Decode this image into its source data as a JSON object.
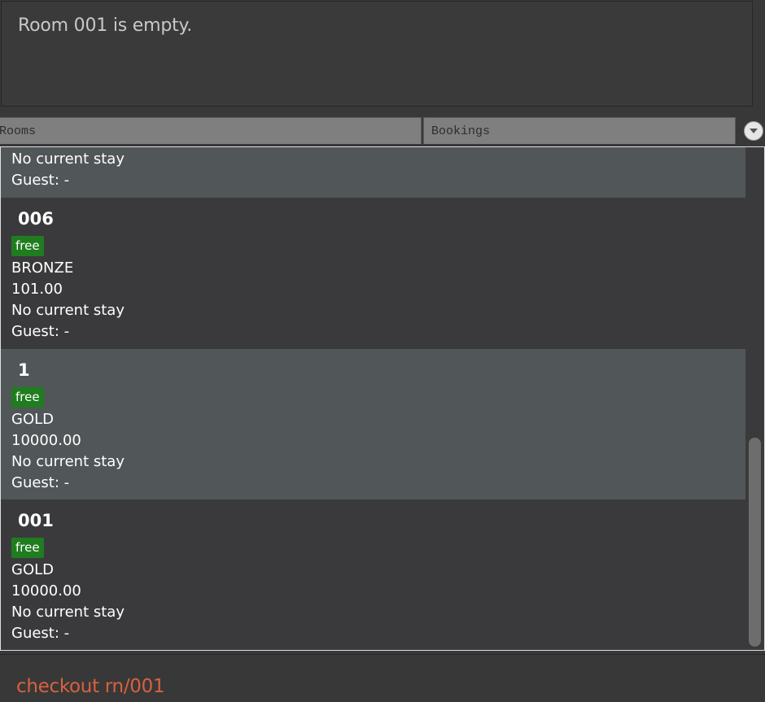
{
  "result_display": {
    "text": "Room 001 is empty."
  },
  "tabs": [
    {
      "label": "Rooms"
    },
    {
      "label": "Bookings"
    }
  ],
  "room_list": [
    {
      "partial": true,
      "stay": "No current stay",
      "guest": "Guest: -"
    },
    {
      "number": "006",
      "status": "free",
      "tier": "BRONZE",
      "price": "101.00",
      "stay": "No current stay",
      "guest": "Guest: -"
    },
    {
      "number": "1",
      "status": "free",
      "tier": "GOLD",
      "price": "10000.00",
      "stay": "No current stay",
      "guest": "Guest: -"
    },
    {
      "number": "001",
      "status": "free",
      "tier": "GOLD",
      "price": "10000.00",
      "stay": "No current stay",
      "guest": "Guest: -"
    }
  ],
  "command_box": {
    "value": "checkout rn/001"
  },
  "colors": {
    "background": "#383838",
    "card_alt": "#515658",
    "card_normal": "#3a3a3c",
    "free_badge": "#1f7d1f",
    "command_text": "#d9613f"
  }
}
